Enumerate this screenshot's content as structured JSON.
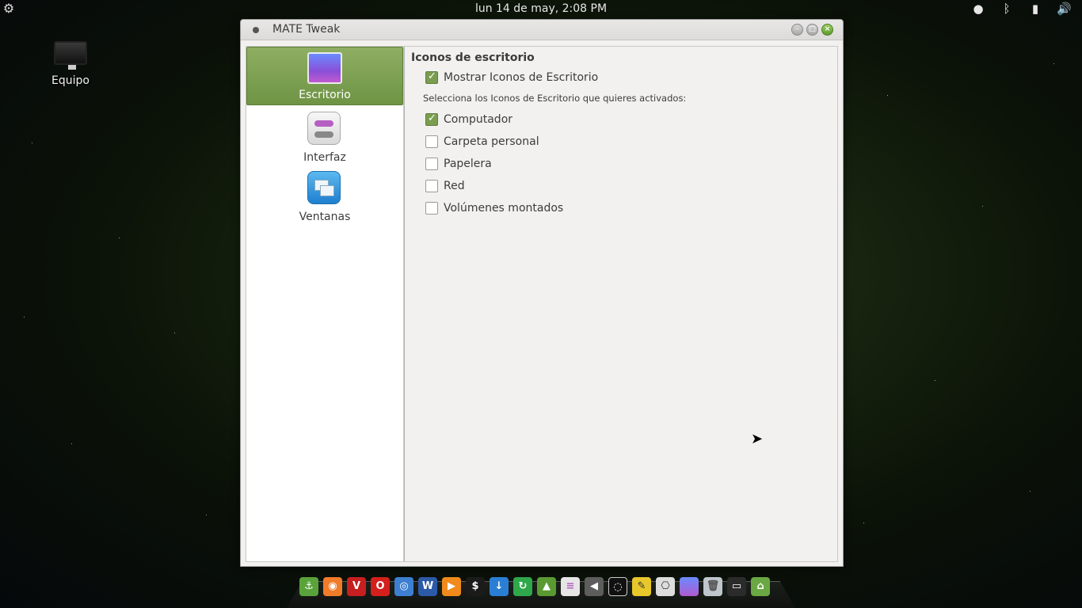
{
  "top_panel": {
    "clock": "lun 14 de may,  2:08 PM"
  },
  "desktop": {
    "icons": [
      {
        "label": "Equipo"
      }
    ]
  },
  "window": {
    "title": "MATE Tweak",
    "sidebar": {
      "items": [
        {
          "label": "Escritorio",
          "active": true
        },
        {
          "label": "Interfaz",
          "active": false
        },
        {
          "label": "Ventanas",
          "active": false
        }
      ]
    },
    "content": {
      "section_title": "Iconos de escritorio",
      "show_icons": {
        "label": "Mostrar Iconos de Escritorio",
        "checked": true
      },
      "hint": "Selecciona los Iconos de Escritorio que quieres activados:",
      "options": [
        {
          "label": "Computador",
          "checked": true
        },
        {
          "label": "Carpeta personal",
          "checked": false
        },
        {
          "label": "Papelera",
          "checked": false
        },
        {
          "label": "Red",
          "checked": false
        },
        {
          "label": "Volúmenes montados",
          "checked": false
        }
      ]
    }
  },
  "colors": {
    "accent_green": "#7a9d4f",
    "sidebar_active": "#6e9444"
  }
}
